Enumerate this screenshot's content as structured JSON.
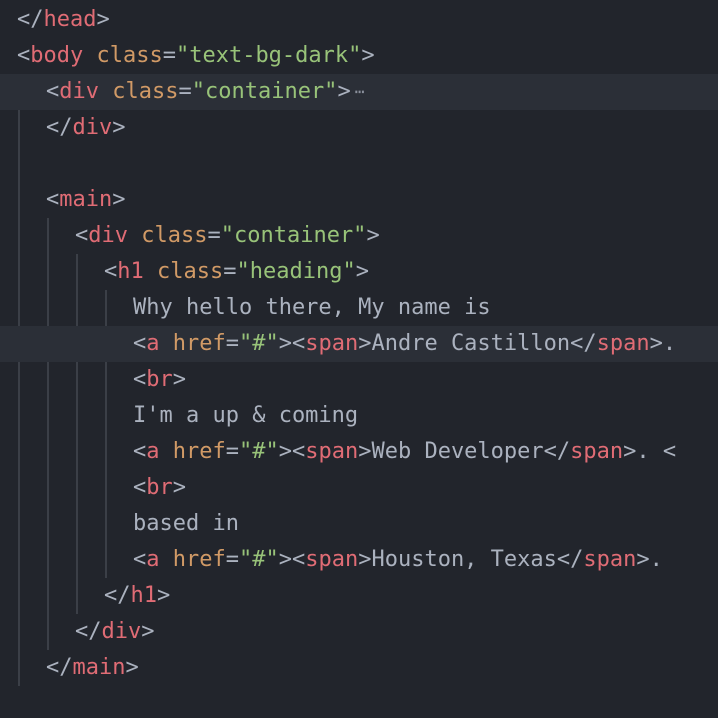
{
  "colors": {
    "background": "#22252c",
    "active_line": "#2b2f37",
    "tag": "#e06c75",
    "attribute": "#d19a66",
    "string": "#98c379",
    "punctuation": "#abb2bf",
    "text": "#abb2bf",
    "indent_guide": "#3b3f47"
  },
  "fold_marker_icon": "ellipsis-icon",
  "lines": [
    {
      "indent": 0,
      "active": false,
      "tokens": [
        {
          "t": "p",
          "v": "</"
        },
        {
          "t": "tag",
          "v": "head"
        },
        {
          "t": "p",
          "v": ">"
        }
      ]
    },
    {
      "indent": 0,
      "active": false,
      "tokens": [
        {
          "t": "p",
          "v": "<"
        },
        {
          "t": "tag",
          "v": "body"
        },
        {
          "t": "p",
          "v": " "
        },
        {
          "t": "attr",
          "v": "class"
        },
        {
          "t": "p",
          "v": "="
        },
        {
          "t": "str",
          "v": "\"text-bg-dark\""
        },
        {
          "t": "p",
          "v": ">"
        }
      ]
    },
    {
      "indent": 1,
      "active": true,
      "folded": true,
      "tokens": [
        {
          "t": "p",
          "v": "<"
        },
        {
          "t": "tag",
          "v": "div"
        },
        {
          "t": "p",
          "v": " "
        },
        {
          "t": "attr",
          "v": "class"
        },
        {
          "t": "p",
          "v": "="
        },
        {
          "t": "str",
          "v": "\"container\""
        },
        {
          "t": "p",
          "v": ">"
        }
      ]
    },
    {
      "indent": 1,
      "active": false,
      "tokens": [
        {
          "t": "p",
          "v": "</"
        },
        {
          "t": "tag",
          "v": "div"
        },
        {
          "t": "p",
          "v": ">"
        }
      ]
    },
    {
      "indent": 0,
      "active": false,
      "tokens": []
    },
    {
      "indent": 1,
      "active": false,
      "tokens": [
        {
          "t": "p",
          "v": "<"
        },
        {
          "t": "tag",
          "v": "main"
        },
        {
          "t": "p",
          "v": ">"
        }
      ]
    },
    {
      "indent": 2,
      "active": false,
      "tokens": [
        {
          "t": "p",
          "v": "<"
        },
        {
          "t": "tag",
          "v": "div"
        },
        {
          "t": "p",
          "v": " "
        },
        {
          "t": "attr",
          "v": "class"
        },
        {
          "t": "p",
          "v": "="
        },
        {
          "t": "str",
          "v": "\"container\""
        },
        {
          "t": "p",
          "v": ">"
        }
      ]
    },
    {
      "indent": 3,
      "active": false,
      "tokens": [
        {
          "t": "p",
          "v": "<"
        },
        {
          "t": "tag",
          "v": "h1"
        },
        {
          "t": "p",
          "v": " "
        },
        {
          "t": "attr",
          "v": "class"
        },
        {
          "t": "p",
          "v": "="
        },
        {
          "t": "str",
          "v": "\"heading\""
        },
        {
          "t": "p",
          "v": ">"
        }
      ]
    },
    {
      "indent": 4,
      "active": false,
      "tokens": [
        {
          "t": "text",
          "v": "Why hello there, My name is"
        }
      ]
    },
    {
      "indent": 4,
      "active": true,
      "tokens": [
        {
          "t": "p",
          "v": "<"
        },
        {
          "t": "tag",
          "v": "a"
        },
        {
          "t": "p",
          "v": " "
        },
        {
          "t": "attr",
          "v": "href"
        },
        {
          "t": "p",
          "v": "="
        },
        {
          "t": "str",
          "v": "\"#\""
        },
        {
          "t": "p",
          "v": "><"
        },
        {
          "t": "tag",
          "v": "span"
        },
        {
          "t": "p",
          "v": ">"
        },
        {
          "t": "text",
          "v": "Andre Castillon"
        },
        {
          "t": "p",
          "v": "</"
        },
        {
          "t": "tag",
          "v": "span"
        },
        {
          "t": "p",
          "v": ">."
        }
      ]
    },
    {
      "indent": 4,
      "active": false,
      "tokens": [
        {
          "t": "p",
          "v": "<"
        },
        {
          "t": "tag",
          "v": "br"
        },
        {
          "t": "p",
          "v": ">"
        }
      ]
    },
    {
      "indent": 4,
      "active": false,
      "tokens": [
        {
          "t": "text",
          "v": "I'm a up & coming"
        }
      ]
    },
    {
      "indent": 4,
      "active": false,
      "tokens": [
        {
          "t": "p",
          "v": "<"
        },
        {
          "t": "tag",
          "v": "a"
        },
        {
          "t": "p",
          "v": " "
        },
        {
          "t": "attr",
          "v": "href"
        },
        {
          "t": "p",
          "v": "="
        },
        {
          "t": "str",
          "v": "\"#\""
        },
        {
          "t": "p",
          "v": "><"
        },
        {
          "t": "tag",
          "v": "span"
        },
        {
          "t": "p",
          "v": ">"
        },
        {
          "t": "text",
          "v": "Web Developer"
        },
        {
          "t": "p",
          "v": "</"
        },
        {
          "t": "tag",
          "v": "span"
        },
        {
          "t": "p",
          "v": ">. <"
        }
      ]
    },
    {
      "indent": 4,
      "active": false,
      "tokens": [
        {
          "t": "p",
          "v": "<"
        },
        {
          "t": "tag",
          "v": "br"
        },
        {
          "t": "p",
          "v": ">"
        }
      ]
    },
    {
      "indent": 4,
      "active": false,
      "tokens": [
        {
          "t": "text",
          "v": "based in"
        }
      ]
    },
    {
      "indent": 4,
      "active": false,
      "tokens": [
        {
          "t": "p",
          "v": "<"
        },
        {
          "t": "tag",
          "v": "a"
        },
        {
          "t": "p",
          "v": " "
        },
        {
          "t": "attr",
          "v": "href"
        },
        {
          "t": "p",
          "v": "="
        },
        {
          "t": "str",
          "v": "\"#\""
        },
        {
          "t": "p",
          "v": "><"
        },
        {
          "t": "tag",
          "v": "span"
        },
        {
          "t": "p",
          "v": ">"
        },
        {
          "t": "text",
          "v": "Houston, Texas"
        },
        {
          "t": "p",
          "v": "</"
        },
        {
          "t": "tag",
          "v": "span"
        },
        {
          "t": "p",
          "v": ">."
        }
      ]
    },
    {
      "indent": 3,
      "active": false,
      "tokens": [
        {
          "t": "p",
          "v": "</"
        },
        {
          "t": "tag",
          "v": "h1"
        },
        {
          "t": "p",
          "v": ">"
        }
      ]
    },
    {
      "indent": 2,
      "active": false,
      "tokens": [
        {
          "t": "p",
          "v": "</"
        },
        {
          "t": "tag",
          "v": "div"
        },
        {
          "t": "p",
          "v": ">"
        }
      ]
    },
    {
      "indent": 1,
      "active": false,
      "tokens": [
        {
          "t": "p",
          "v": "</"
        },
        {
          "t": "tag",
          "v": "main"
        },
        {
          "t": "p",
          "v": ">"
        }
      ]
    },
    {
      "indent": 0,
      "active": false,
      "tokens": []
    }
  ]
}
